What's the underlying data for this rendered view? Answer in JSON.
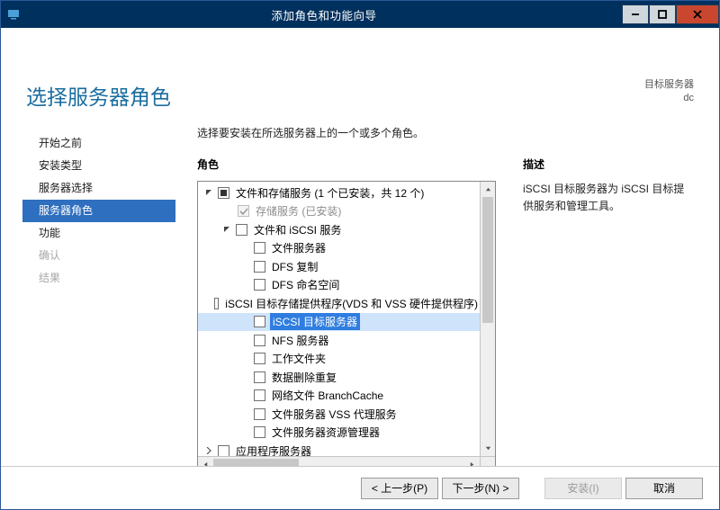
{
  "window": {
    "title": "添加角色和功能向导"
  },
  "page": {
    "heading": "选择服务器角色",
    "target_label": "目标服务器",
    "target_value": "dc",
    "instruction": "选择要安装在所选服务器上的一个或多个角色。"
  },
  "sidebar": {
    "items": [
      {
        "label": "开始之前",
        "state": "normal"
      },
      {
        "label": "安装类型",
        "state": "normal"
      },
      {
        "label": "服务器选择",
        "state": "normal"
      },
      {
        "label": "服务器角色",
        "state": "active"
      },
      {
        "label": "功能",
        "state": "normal"
      },
      {
        "label": "确认",
        "state": "dim"
      },
      {
        "label": "结果",
        "state": "dim"
      }
    ]
  },
  "roles": {
    "section_label": "角色",
    "tree": {
      "root": {
        "label": "文件和存储服务 (1 个已安装，共 12 个)",
        "check": "ind",
        "expanded": true
      },
      "c1": {
        "label": "存储服务 (已安装)",
        "check": "chk-disabled"
      },
      "c2": {
        "label": "文件和 iSCSI 服务",
        "check": "empty",
        "expanded": true
      },
      "c2_0": {
        "label": "文件服务器",
        "check": "empty"
      },
      "c2_1": {
        "label": "DFS 复制",
        "check": "empty"
      },
      "c2_2": {
        "label": "DFS 命名空间",
        "check": "empty"
      },
      "c2_3": {
        "label": "iSCSI 目标存储提供程序(VDS 和 VSS 硬件提供程序)",
        "check": "empty"
      },
      "c2_4": {
        "label": "iSCSI 目标服务器",
        "check": "empty",
        "selected": true
      },
      "c2_5": {
        "label": "NFS 服务器",
        "check": "empty"
      },
      "c2_6": {
        "label": "工作文件夹",
        "check": "empty"
      },
      "c2_7": {
        "label": "数据删除重复",
        "check": "empty"
      },
      "c2_8": {
        "label": "网络文件 BranchCache",
        "check": "empty"
      },
      "c2_9": {
        "label": "文件服务器 VSS 代理服务",
        "check": "empty"
      },
      "c2_10": {
        "label": "文件服务器资源管理器",
        "check": "empty"
      },
      "next_root": {
        "label": "应用程序服务器",
        "check": "empty"
      }
    }
  },
  "description": {
    "section_label": "描述",
    "text": "iSCSI 目标服务器为 iSCSI 目标提供服务和管理工具。"
  },
  "buttons": {
    "prev": "< 上一步(P)",
    "next": "下一步(N) >",
    "install": "安装(I)",
    "cancel": "取消"
  }
}
